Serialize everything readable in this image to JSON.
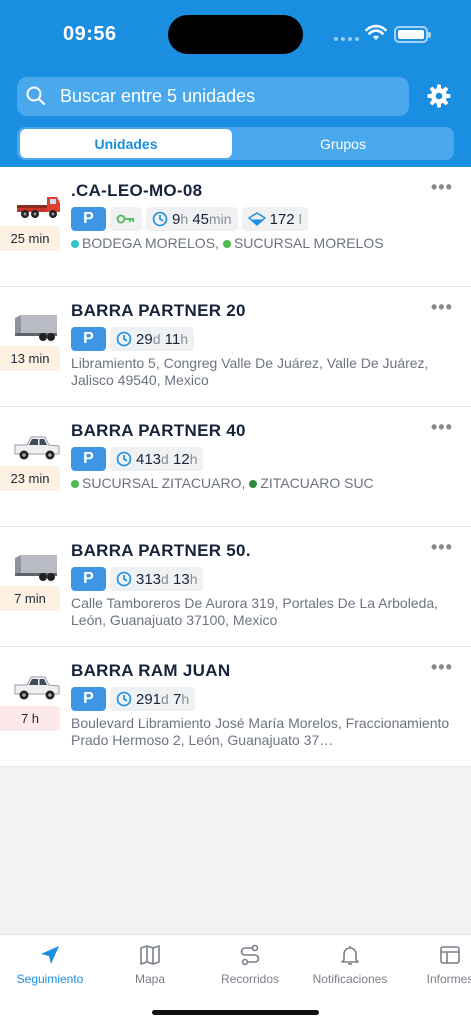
{
  "status": {
    "time": "09:56"
  },
  "search": {
    "placeholder": "Buscar entre 5 unidades"
  },
  "segments": {
    "active": "Unidades",
    "inactive": "Grupos"
  },
  "units": [
    {
      "name": ".CA-LEO-MO-08",
      "ago": "25 min",
      "vehicle": "flatbed-truck-icon",
      "duration": {
        "d": "9",
        "du": "h",
        "h": "45",
        "hu": "min"
      },
      "fuel": {
        "value": "172",
        "unit": "l"
      },
      "tags": [
        {
          "label": "BODEGA MORELOS,",
          "color": "#2ec5c9"
        },
        {
          "label": "SUCURSAL MORELOS",
          "color": "#4cbb54"
        }
      ]
    },
    {
      "name": "BARRA PARTNER 20",
      "ago": "13 min",
      "vehicle": "trailer-icon",
      "duration": {
        "d": "29",
        "du": "d",
        "h": "11",
        "hu": "h"
      },
      "address": "Libramiento 5, Congreg Valle De Juárez, Valle De Juárez, Jalisco 49540, Mexico"
    },
    {
      "name": "BARRA PARTNER 40",
      "ago": "23 min",
      "vehicle": "pickup-truck-icon",
      "duration": {
        "d": "413",
        "du": "d",
        "h": "12",
        "hu": "h"
      },
      "tags": [
        {
          "label": "SUCURSAL ZITACUARO,",
          "color": "#4cbb54"
        },
        {
          "label": "ZITACUARO SUC",
          "color": "#2e8b3c"
        }
      ]
    },
    {
      "name": "BARRA PARTNER 50.",
      "ago": "7 min",
      "vehicle": "trailer-icon",
      "duration": {
        "d": "313",
        "du": "d",
        "h": "13",
        "hu": "h"
      },
      "address": "Calle Tamboreros De Aurora 319, Portales De La Arboleda, León, Guanajuato 37100, Mexico"
    },
    {
      "name": "BARRA RAM JUAN",
      "ago": "7 h",
      "vehicle": "pickup-truck-icon",
      "duration": {
        "d": "291",
        "du": "d",
        "h": "7",
        "hu": "h"
      },
      "address": "Boulevard Libramiento José María Morelos, Fraccionamiento Prado Hermoso 2, León, Guanajuato 37…"
    }
  ],
  "parking_label": "P",
  "more_label": "•••",
  "tabs": [
    "Seguimiento",
    "Mapa",
    "Recorridos",
    "Notificaciones",
    "Informes"
  ],
  "colors": {
    "brand": "#1a8ee0",
    "parking": "#3d95e6"
  }
}
